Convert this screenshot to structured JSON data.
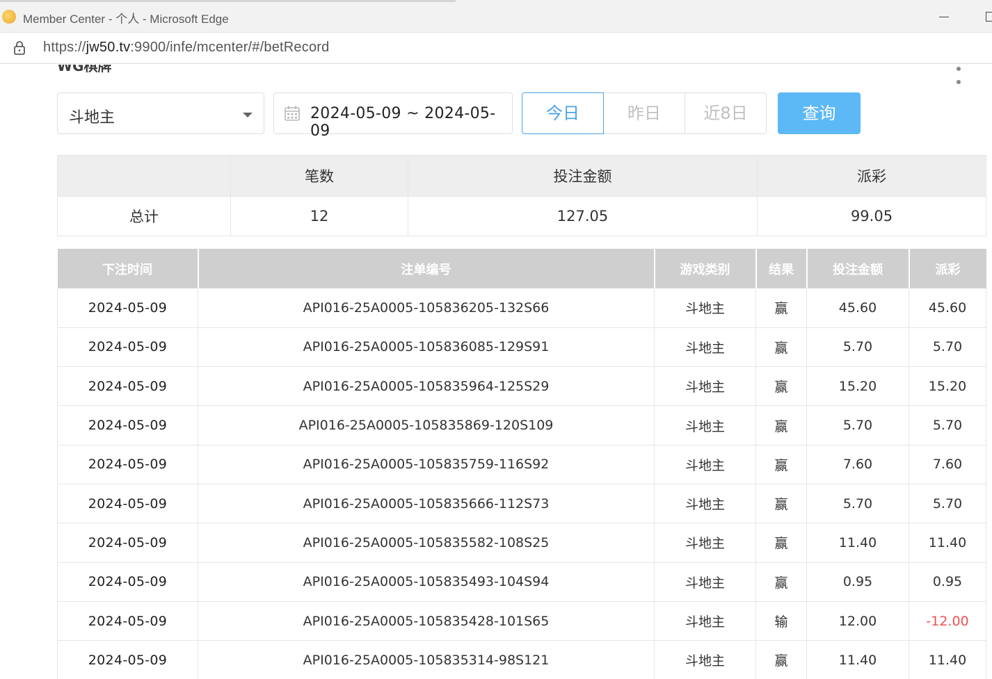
{
  "browser": {
    "window_title": "Member Center - 个人 - Microsoft Edge",
    "url_prefix": "https://",
    "url_host": "jw50.tv",
    "url_rest": ":9900/infe/mcenter/#/betRecord"
  },
  "section": {
    "title_cut": "WG棋牌"
  },
  "filters": {
    "game_select_value": "斗地主",
    "date_range": "2024-05-09 ~ 2024-05-09",
    "quick_ranges": [
      "今日",
      "昨日",
      "近8日"
    ],
    "active_range": "今日",
    "query_label": "查询"
  },
  "summary": {
    "headers": [
      "",
      "笔数",
      "投注金额",
      "派彩"
    ],
    "row": {
      "label": "总计",
      "count": "12",
      "bet_amount": "127.05",
      "payout": "99.05"
    }
  },
  "records": {
    "headers": [
      "下注时间",
      "注单编号",
      "游戏类别",
      "结果",
      "投注金额",
      "派彩"
    ],
    "rows": [
      {
        "time": "2024-05-09",
        "id": "API016-25A0005-105836205-132S66",
        "game": "斗地主",
        "result": "赢",
        "bet": "45.60",
        "payout": "45.60"
      },
      {
        "time": "2024-05-09",
        "id": "API016-25A0005-105836085-129S91",
        "game": "斗地主",
        "result": "赢",
        "bet": "5.70",
        "payout": "5.70"
      },
      {
        "time": "2024-05-09",
        "id": "API016-25A0005-105835964-125S29",
        "game": "斗地主",
        "result": "赢",
        "bet": "15.20",
        "payout": "15.20"
      },
      {
        "time": "2024-05-09",
        "id": "API016-25A0005-105835869-120S109",
        "game": "斗地主",
        "result": "赢",
        "bet": "5.70",
        "payout": "5.70"
      },
      {
        "time": "2024-05-09",
        "id": "API016-25A0005-105835759-116S92",
        "game": "斗地主",
        "result": "赢",
        "bet": "7.60",
        "payout": "7.60"
      },
      {
        "time": "2024-05-09",
        "id": "API016-25A0005-105835666-112S73",
        "game": "斗地主",
        "result": "赢",
        "bet": "5.70",
        "payout": "5.70"
      },
      {
        "time": "2024-05-09",
        "id": "API016-25A0005-105835582-108S25",
        "game": "斗地主",
        "result": "赢",
        "bet": "11.40",
        "payout": "11.40"
      },
      {
        "time": "2024-05-09",
        "id": "API016-25A0005-105835493-104S94",
        "game": "斗地主",
        "result": "赢",
        "bet": "0.95",
        "payout": "0.95"
      },
      {
        "time": "2024-05-09",
        "id": "API016-25A0005-105835428-101S65",
        "game": "斗地主",
        "result": "输",
        "bet": "12.00",
        "payout": "-12.00"
      },
      {
        "time": "2024-05-09",
        "id": "API016-25A0005-105835314-98S121",
        "game": "斗地主",
        "result": "赢",
        "bet": "11.40",
        "payout": "11.40"
      }
    ]
  },
  "colors": {
    "accent_blue": "#4aa3e8",
    "query_button": "#5db8f6",
    "negative_payout": "#f05050",
    "table_header_bg": "#cfcfcf"
  },
  "icons": [
    "browser-favicon-icon",
    "lock-icon",
    "calendar-icon",
    "chevron-down-icon"
  ]
}
